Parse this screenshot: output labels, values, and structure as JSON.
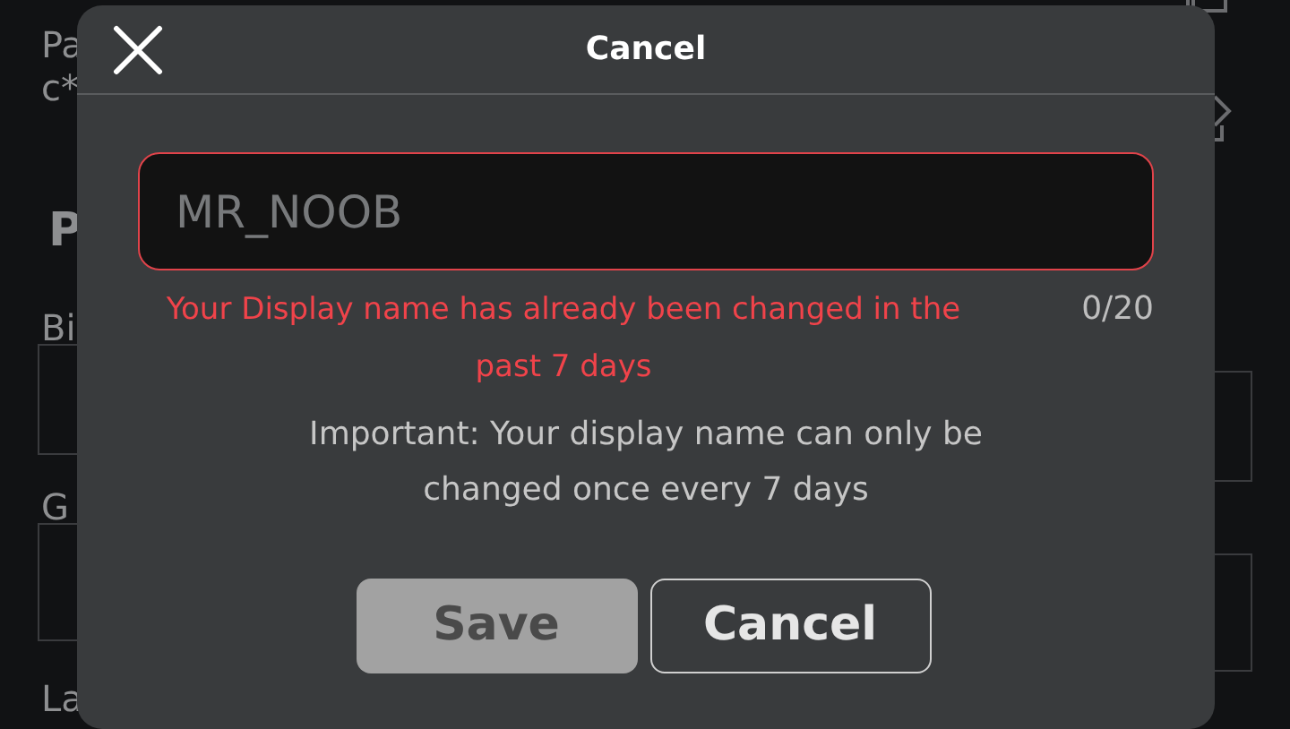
{
  "background": {
    "texts": [
      {
        "kind": "label",
        "text": "Pa"
      },
      {
        "kind": "label",
        "text": "c*"
      },
      {
        "kind": "heading",
        "text": "P"
      },
      {
        "kind": "label",
        "text": "Bi"
      },
      {
        "kind": "field"
      },
      {
        "kind": "label",
        "text": "G"
      },
      {
        "kind": "field"
      },
      {
        "kind": "label",
        "text": "La"
      }
    ]
  },
  "dialog": {
    "title": "Cancel",
    "name_field": {
      "placeholder": "MR_NOOB",
      "error": true
    },
    "error_message": "Your Display name has already been changed in the past 7 days",
    "counter": "0/20",
    "note": "Important: Your display name can only be changed once every 7 days",
    "buttons": [
      {
        "label": "Save",
        "disabled": true
      },
      {
        "label": "Cancel",
        "disabled": false
      }
    ]
  }
}
